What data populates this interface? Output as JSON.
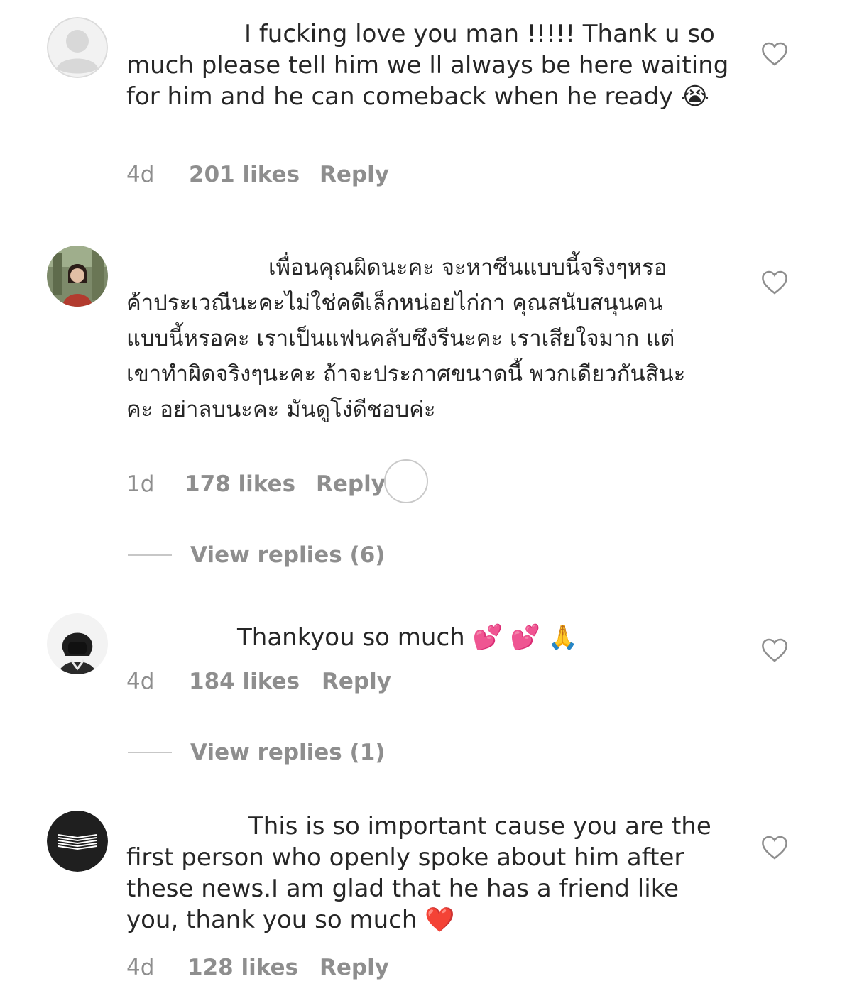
{
  "comments": [
    {
      "text": "I fucking love you man !!!!! Thank u so much please tell him we ll always be here waiting for him and he can comeback when he ready",
      "emoji": "😭",
      "age": "4d",
      "likes": "201 likes",
      "reply": "Reply"
    },
    {
      "text": "เพื่อนคุณผิดนะคะ จะหาซีนแบบนี้จริงๆหรอ ค้าประเวณีนะคะไม่ใช่คดีเล็กหน่อยไก่กา คุณสนับสนุนคนแบบนี้หรอคะ เราเป็นแฟนคลับซึงรีนะคะ เราเสียใจมาก แต่เขาทำผิดจริงๆนะคะ ถ้าจะประกาศขนาดนี้ พวกเดียวกันสินะคะ อย่าลบนะคะ มันดูโง่ดีชอบค่ะ",
      "age": "1d",
      "likes": "178 likes",
      "reply": "Reply",
      "view_replies": "View replies (6)"
    },
    {
      "text": "Thankyou so much",
      "emoji": "💕 💕 🙏",
      "age": "4d",
      "likes": "184 likes",
      "reply": "Reply",
      "view_replies": "View replies (1)"
    },
    {
      "text": "This is so important cause you are the first person who openly spoke about him after these news.I am glad that he has a friend like you, thank you so much",
      "emoji": "❤️",
      "age": "4d",
      "likes": "128 likes",
      "reply": "Reply"
    }
  ],
  "colors": {
    "text": "#262626",
    "meta": "#8e8e8e",
    "heart_outline": "#8e8e8e"
  },
  "icons": {
    "heart": "heart-outline-icon",
    "default_avatar": "default-avatar-icon"
  }
}
